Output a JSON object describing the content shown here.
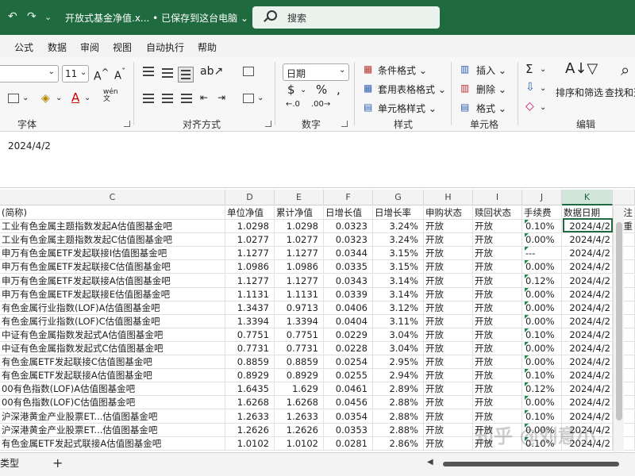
{
  "titlebar": {
    "title": "开放式基金净值.x...  •  已保存到这台电脑 ⌄",
    "search_placeholder": "搜索",
    "undo_icon": "↶",
    "redo_icon": "↷",
    "quick_access_icon": "⌄"
  },
  "menu": [
    "公式",
    "数据",
    "审阅",
    "视图",
    "自动执行",
    "帮助"
  ],
  "ribbon": {
    "font_size": "11",
    "number_format": "日期",
    "group_font": "字体",
    "group_align": "对齐方式",
    "group_number": "数字",
    "group_style": "样式",
    "group_cells": "单元格",
    "group_edit": "编辑",
    "cond_format": "条件格式 ⌄",
    "table_format": "套用表格格式 ⌄",
    "cell_style": "单元格样式 ⌄",
    "insert": "插入 ⌄",
    "delete": "删除 ⌄",
    "format": "格式 ⌄",
    "sort_filter": "排序和筛选",
    "find_select": "查找和选"
  },
  "formula_bar": {
    "value": "2024/4/2"
  },
  "columns": [
    {
      "letter": "C",
      "header": "(简称)"
    },
    {
      "letter": "D",
      "header": "单位净值"
    },
    {
      "letter": "E",
      "header": "累计净值"
    },
    {
      "letter": "F",
      "header": "日增长值"
    },
    {
      "letter": "G",
      "header": "日增长率"
    },
    {
      "letter": "H",
      "header": "申购状态"
    },
    {
      "letter": "I",
      "header": "赎回状态"
    },
    {
      "letter": "J",
      "header": "手续费"
    },
    {
      "letter": "K",
      "header": "数据日期"
    },
    {
      "letter": "",
      "header": "备注"
    }
  ],
  "rows": [
    {
      "name": "工业有色金属主题指数发起A估值图基金吧",
      "nav": "1.0298",
      "acc": "1.0298",
      "chg": "0.0323",
      "pct": "3.24%",
      "buy": "开放",
      "redeem": "开放",
      "fee": "0.10%",
      "date": "2024/4/2",
      "note": "郑重"
    },
    {
      "name": "工业有色金属主题指数发起C估值图基金吧",
      "nav": "1.0277",
      "acc": "1.0277",
      "chg": "0.0323",
      "pct": "3.24%",
      "buy": "开放",
      "redeem": "开放",
      "fee": "0.00%",
      "date": "2024/4/2",
      "note": ""
    },
    {
      "name": "申万有色金属ETF发起联接I估值图基金吧",
      "nav": "1.1277",
      "acc": "1.1277",
      "chg": "0.0344",
      "pct": "3.15%",
      "buy": "开放",
      "redeem": "开放",
      "fee": "---",
      "date": "2024/4/2",
      "note": ""
    },
    {
      "name": "申万有色金属ETF发起联接C估值图基金吧",
      "nav": "1.0986",
      "acc": "1.0986",
      "chg": "0.0335",
      "pct": "3.15%",
      "buy": "开放",
      "redeem": "开放",
      "fee": "0.00%",
      "date": "2024/4/2",
      "note": ""
    },
    {
      "name": "申万有色金属ETF发起联接A估值图基金吧",
      "nav": "1.1277",
      "acc": "1.1277",
      "chg": "0.0343",
      "pct": "3.14%",
      "buy": "开放",
      "redeem": "开放",
      "fee": "0.12%",
      "date": "2024/4/2",
      "note": ""
    },
    {
      "name": "申万有色金属ETF发起联接E估值图基金吧",
      "nav": "1.1131",
      "acc": "1.1131",
      "chg": "0.0339",
      "pct": "3.14%",
      "buy": "开放",
      "redeem": "开放",
      "fee": "0.00%",
      "date": "2024/4/2",
      "note": ""
    },
    {
      "name": "有色金属行业指数(LOF)A估值图基金吧",
      "nav": "1.3437",
      "acc": "0.9713",
      "chg": "0.0406",
      "pct": "3.12%",
      "buy": "开放",
      "redeem": "开放",
      "fee": "0.00%",
      "date": "2024/4/2",
      "note": ""
    },
    {
      "name": "有色金属行业指数(LOF)C估值图基金吧",
      "nav": "1.3394",
      "acc": "1.3394",
      "chg": "0.0404",
      "pct": "3.11%",
      "buy": "开放",
      "redeem": "开放",
      "fee": "0.00%",
      "date": "2024/4/2",
      "note": ""
    },
    {
      "name": "中证有色金属指数发起式A估值图基金吧",
      "nav": "0.7751",
      "acc": "0.7751",
      "chg": "0.0229",
      "pct": "3.04%",
      "buy": "开放",
      "redeem": "开放",
      "fee": "0.10%",
      "date": "2024/4/2",
      "note": ""
    },
    {
      "name": "中证有色金属指数发起式C估值图基金吧",
      "nav": "0.7731",
      "acc": "0.7731",
      "chg": "0.0228",
      "pct": "3.04%",
      "buy": "开放",
      "redeem": "开放",
      "fee": "0.00%",
      "date": "2024/4/2",
      "note": ""
    },
    {
      "name": "有色金属ETF发起联接C估值图基金吧",
      "nav": "0.8859",
      "acc": "0.8859",
      "chg": "0.0254",
      "pct": "2.95%",
      "buy": "开放",
      "redeem": "开放",
      "fee": "0.00%",
      "date": "2024/4/2",
      "note": ""
    },
    {
      "name": "有色金属ETF发起联接A估值图基金吧",
      "nav": "0.8929",
      "acc": "0.8929",
      "chg": "0.0255",
      "pct": "2.94%",
      "buy": "开放",
      "redeem": "开放",
      "fee": "0.10%",
      "date": "2024/4/2",
      "note": ""
    },
    {
      "name": "00有色指数(LOF)A估值图基金吧",
      "nav": "1.6435",
      "acc": "1.629",
      "chg": "0.0461",
      "pct": "2.89%",
      "buy": "开放",
      "redeem": "开放",
      "fee": "0.12%",
      "date": "2024/4/2",
      "note": ""
    },
    {
      "name": "00有色指数(LOF)C估值图基金吧",
      "nav": "1.6268",
      "acc": "1.6268",
      "chg": "0.0456",
      "pct": "2.88%",
      "buy": "开放",
      "redeem": "开放",
      "fee": "0.00%",
      "date": "2024/4/2",
      "note": ""
    },
    {
      "name": "沪深港黄金产业股票ET...估值图基金吧",
      "nav": "1.2633",
      "acc": "1.2633",
      "chg": "0.0354",
      "pct": "2.88%",
      "buy": "开放",
      "redeem": "开放",
      "fee": "0.10%",
      "date": "2024/4/2",
      "note": ""
    },
    {
      "name": "沪深港黄金产业股票ET...估值图基金吧",
      "nav": "1.2626",
      "acc": "1.2626",
      "chg": "0.0353",
      "pct": "2.88%",
      "buy": "开放",
      "redeem": "开放",
      "fee": "0.00%",
      "date": "2024/4/2",
      "note": ""
    },
    {
      "name": "有色金属ETF发起式联接A估值图基金吧",
      "nav": "1.0102",
      "acc": "1.0102",
      "chg": "0.0281",
      "pct": "2.86%",
      "buy": "开放",
      "redeem": "开放",
      "fee": "0.10%",
      "date": "2024/4/2",
      "note": ""
    }
  ],
  "selected_cell_value": "2024/4/2",
  "sheet_tab": "类型",
  "add_sheet_icon": "+",
  "watermark": "知乎 @刘意小",
  "accent": "#1f6b3f"
}
